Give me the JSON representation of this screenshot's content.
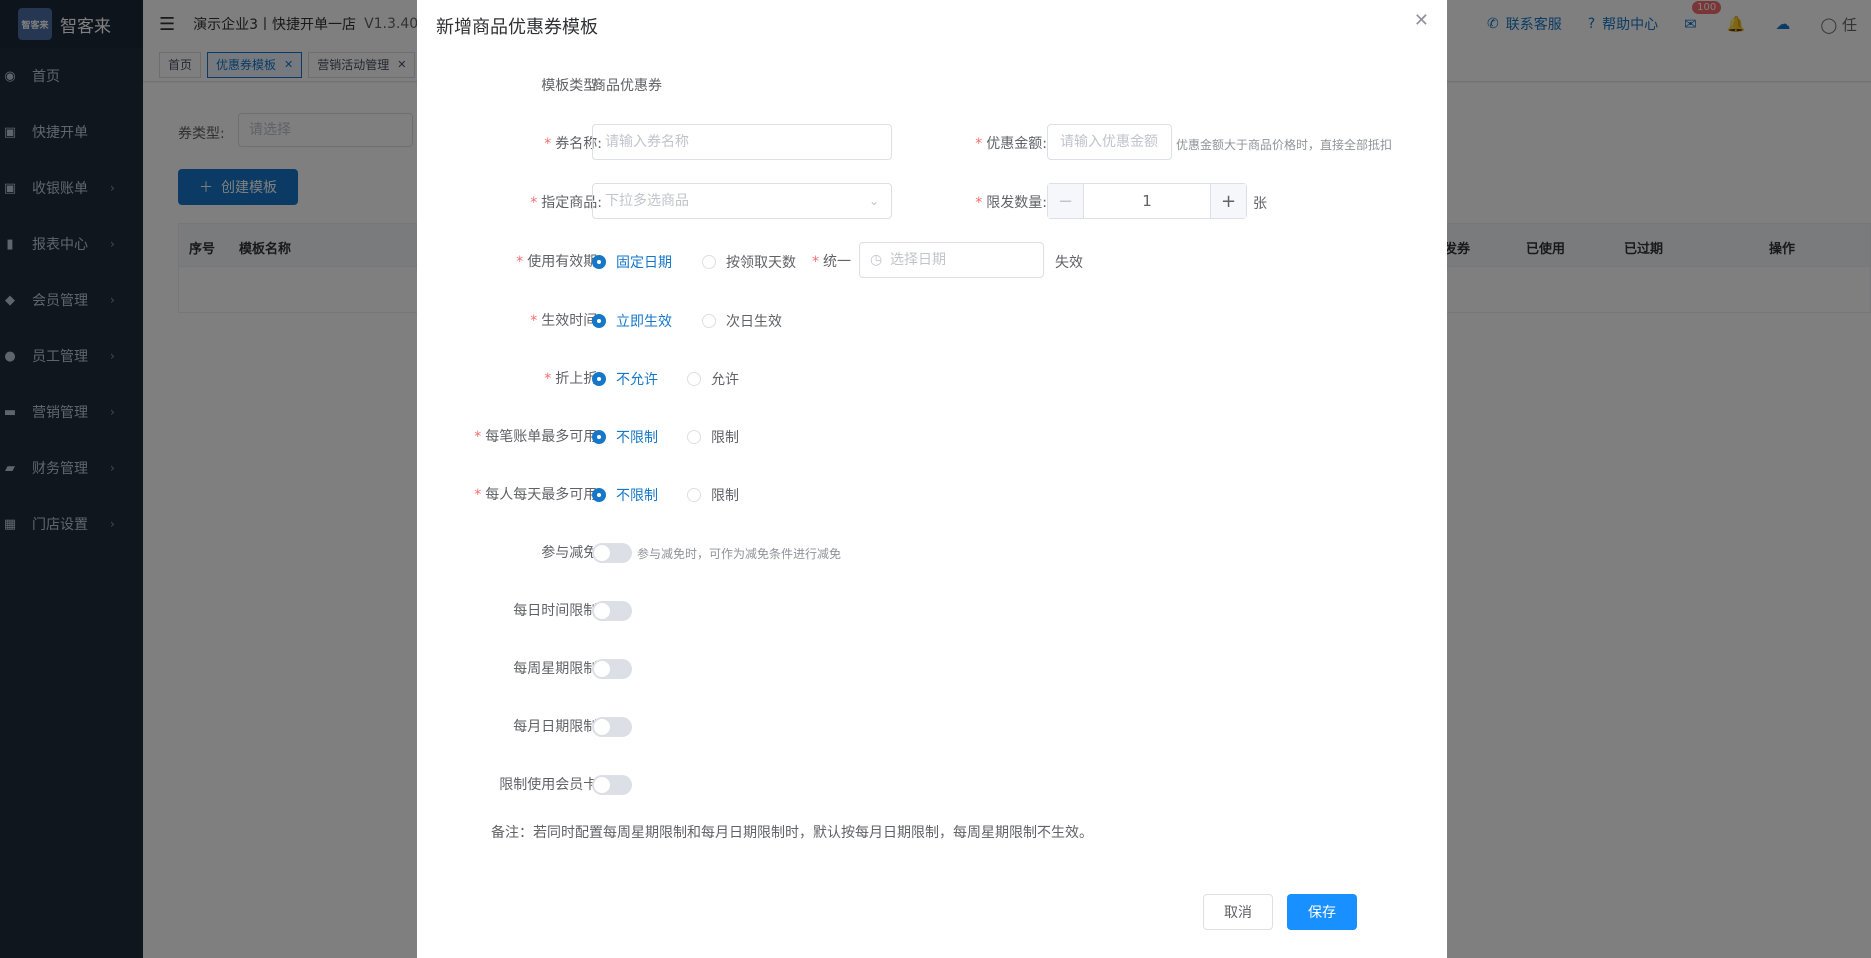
{
  "app": {
    "name": "智客来",
    "logo_text": "智客来",
    "title": "演示企业3丨快捷开单一店",
    "version": "V1.3.40"
  },
  "sidebar": {
    "items": [
      {
        "label": "首页",
        "icon": "dashboard-icon",
        "arrow": false
      },
      {
        "label": "快捷开单",
        "icon": "bag-icon",
        "arrow": false
      },
      {
        "label": "收银账单",
        "icon": "money-bag-icon",
        "arrow": true
      },
      {
        "label": "报表中心",
        "icon": "bar-chart-icon",
        "arrow": true
      },
      {
        "label": "会员管理",
        "icon": "diamond-icon",
        "arrow": true
      },
      {
        "label": "员工管理",
        "icon": "user-icon",
        "arrow": true
      },
      {
        "label": "营销管理",
        "icon": "briefcase-icon",
        "arrow": true
      },
      {
        "label": "财务管理",
        "icon": "wallet-icon",
        "arrow": true
      },
      {
        "label": "门店设置",
        "icon": "grid-icon",
        "arrow": true
      }
    ]
  },
  "header": {
    "support": "联系客服",
    "help": "帮助中心",
    "mail_badge": "100",
    "user_initial": "任"
  },
  "tabs": [
    {
      "label": "首页",
      "active": false,
      "closable": false
    },
    {
      "label": "优惠券模板",
      "active": true,
      "closable": true
    },
    {
      "label": "营销活动管理",
      "active": false,
      "closable": true
    }
  ],
  "main": {
    "filter_label": "券类型:",
    "filter_placeholder": "请选择",
    "create_button": "创建模板",
    "table_headers": [
      "序号",
      "模板名称",
      "发券",
      "已使用",
      "已过期",
      "操作"
    ]
  },
  "dialog": {
    "title": "新增商品优惠券模板",
    "template_type_label": "模板类型:",
    "template_type_value": "商品优惠券",
    "coupon_name_label": "券名称:",
    "coupon_name_placeholder": "请输入券名称",
    "discount_amount_label": "优惠金额:",
    "discount_amount_placeholder": "请输入优惠金额",
    "discount_amount_hint": "优惠金额大于商品价格时，直接全部抵扣",
    "goods_label": "指定商品:",
    "goods_placeholder": "下拉多选商品",
    "limit_qty_label": "限发数量:",
    "limit_qty_value": "1",
    "limit_qty_unit": "张",
    "validity_label": "使用有效期:",
    "validity_fixed": "固定日期",
    "validity_days": "按领取天数",
    "unified_label": "统一",
    "date_placeholder": "选择日期",
    "expire_text": "失效",
    "effective_label": "生效时间:",
    "effective_now": "立即生效",
    "effective_next": "次日生效",
    "stack_label": "折上折:",
    "stack_no": "不允许",
    "stack_yes": "允许",
    "per_bill_label": "每笔账单最多可用:",
    "per_bill_no": "不限制",
    "per_bill_yes": "限制",
    "per_day_label": "每人每天最多可用:",
    "per_day_no": "不限制",
    "per_day_yes": "限制",
    "reduce_label": "参与减免:",
    "reduce_hint": "参与减免时，可作为减免条件进行减免",
    "daily_time_label": "每日时间限制:",
    "weekly_label": "每周星期限制:",
    "monthly_label": "每月日期限制:",
    "member_card_label": "限制使用会员卡:",
    "note": "备注：若同时配置每周星期限制和每月日期限制时，默认按每月日期限制，每周星期限制不生效。",
    "cancel": "取消",
    "save": "保存"
  },
  "colors": {
    "primary": "#1677c9",
    "save": "#1890ff",
    "required": "#f56c6c",
    "sidebar": "#1f2d3d"
  }
}
